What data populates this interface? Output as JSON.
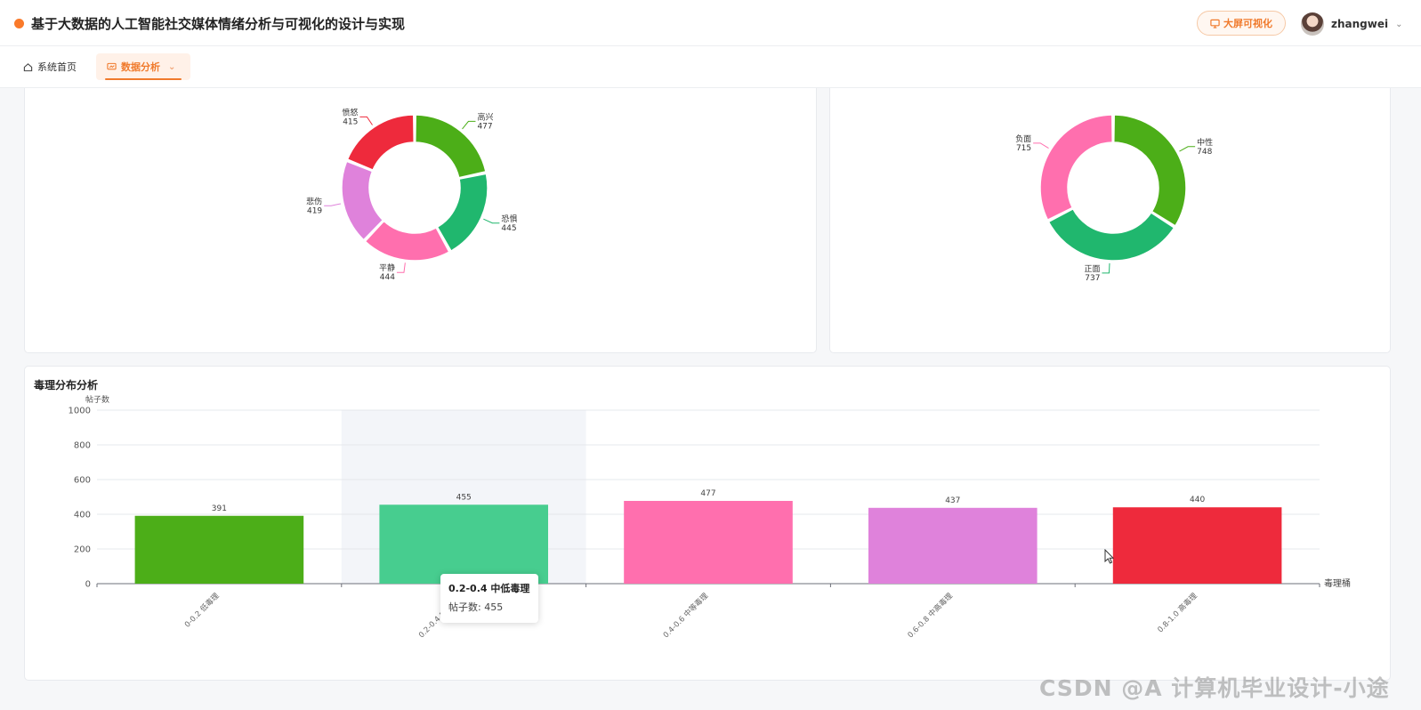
{
  "header": {
    "title": "基于大数据的人工智能社交媒体情绪分析与可视化的设计与实现",
    "bigscreen_label": "大屏可视化",
    "username": "zhangwei"
  },
  "tabs": [
    {
      "label": "系统首页",
      "active": false
    },
    {
      "label": "数据分析",
      "active": true
    }
  ],
  "chart_data": [
    {
      "type": "pie",
      "variant": "donut",
      "labels": [
        "高兴",
        "恐惧",
        "平静",
        "悲伤",
        "愤怒"
      ],
      "values": [
        477,
        445,
        444,
        419,
        415
      ],
      "colors": [
        "#4cae18",
        "#20b76e",
        "#ff6fae",
        "#df82db",
        "#ee2a3c"
      ]
    },
    {
      "type": "pie",
      "variant": "donut",
      "labels": [
        "中性",
        "正面",
        "负面"
      ],
      "values": [
        748,
        737,
        715
      ],
      "colors": [
        "#4cae18",
        "#20b76e",
        "#ff6fae"
      ]
    },
    {
      "type": "bar",
      "title": "毒理分布分析",
      "ylabel": "帖子数",
      "xlabel": "毒理桶",
      "categories": [
        "0-0.2 低毒理",
        "0.2-0.4 中低毒理",
        "0.4-0.6 中等毒理",
        "0.6-0.8 中高毒理",
        "0.8-1.0 高毒理"
      ],
      "values": [
        391,
        455,
        477,
        437,
        440
      ],
      "colors": [
        "#4cae18",
        "#47cd8f",
        "#ff6fae",
        "#df82db",
        "#ee2a3c"
      ],
      "ylim": [
        0,
        1000
      ],
      "yticks": [
        0,
        200,
        400,
        600,
        800,
        1000
      ],
      "grid": true,
      "highlighted_index": 1
    }
  ],
  "tooltip": {
    "title": "0.2-0.4 中低毒理",
    "row": "帖子数:  455"
  },
  "watermark": "CSDN @A 计算机毕业设计-小途"
}
